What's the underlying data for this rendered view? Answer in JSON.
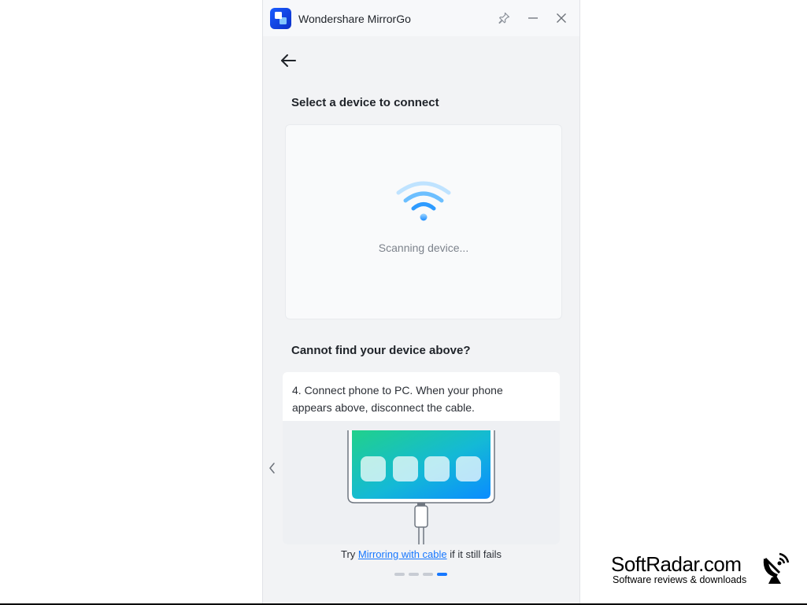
{
  "window": {
    "title": "Wondershare MirrorGo",
    "controls": {
      "pin_icon": "pin-icon",
      "minimize_icon": "minimize-icon",
      "close_icon": "close-icon"
    }
  },
  "nav": {
    "back_icon": "arrow-left-icon"
  },
  "device_select": {
    "heading": "Select a device to connect",
    "status": "Scanning device...",
    "status_icon": "wifi-icon"
  },
  "help": {
    "heading": "Cannot find your device above?",
    "step_text": "4. Connect phone to PC. When your phone appears above, disconnect the cable.",
    "illustration": "phone-with-usb-cable-illustration",
    "footer_prefix": "Try ",
    "footer_link": "Mirroring with cable",
    "footer_suffix": " if it still fails",
    "carousel": {
      "total": 4,
      "active_index": 3
    }
  },
  "watermark": {
    "name": "SoftRadar.com",
    "tagline": "Software reviews & downloads"
  },
  "colors": {
    "accent": "#1677ff",
    "window_bg": "#f2f3f5",
    "text": "#1f2329",
    "muted": "#7d838c"
  }
}
